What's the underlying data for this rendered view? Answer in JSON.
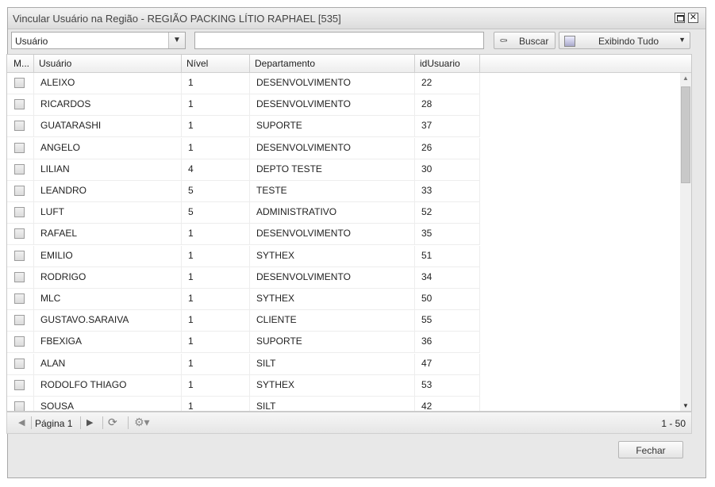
{
  "window": {
    "title": "Vincular Usuário na Região - REGIÃO PACKING LÍTIO RAPHAEL [535]",
    "close_glyph": "✕"
  },
  "toolbar": {
    "field_select": "Usuário",
    "search_value": "",
    "buscar_label": "Buscar",
    "buscar_icon": "filter-icon",
    "exibindo_label": "Exibindo Tudo"
  },
  "grid": {
    "columns": [
      "M...",
      "Usuário",
      "Nível",
      "Departamento",
      "idUsuario"
    ],
    "rows": [
      {
        "usuario": "ALEIXO",
        "nivel": "1",
        "departamento": "DESENVOLVIMENTO",
        "id": "22"
      },
      {
        "usuario": "RICARDOS",
        "nivel": "1",
        "departamento": "DESENVOLVIMENTO",
        "id": "28"
      },
      {
        "usuario": "GUATARASHI",
        "nivel": "1",
        "departamento": "SUPORTE",
        "id": "37"
      },
      {
        "usuario": "ANGELO",
        "nivel": "1",
        "departamento": "DESENVOLVIMENTO",
        "id": "26"
      },
      {
        "usuario": "LILIAN",
        "nivel": "4",
        "departamento": "DEPTO TESTE",
        "id": "30"
      },
      {
        "usuario": "LEANDRO",
        "nivel": "5",
        "departamento": "TESTE",
        "id": "33"
      },
      {
        "usuario": "LUFT",
        "nivel": "5",
        "departamento": "ADMINISTRATIVO",
        "id": "52"
      },
      {
        "usuario": "RAFAEL",
        "nivel": "1",
        "departamento": "DESENVOLVIMENTO",
        "id": "35"
      },
      {
        "usuario": "EMILIO",
        "nivel": "1",
        "departamento": "SYTHEX",
        "id": "51"
      },
      {
        "usuario": "RODRIGO",
        "nivel": "1",
        "departamento": "DESENVOLVIMENTO",
        "id": "34"
      },
      {
        "usuario": "MLC",
        "nivel": "1",
        "departamento": "SYTHEX",
        "id": "50"
      },
      {
        "usuario": "GUSTAVO.SARAIVA",
        "nivel": "1",
        "departamento": "CLIENTE",
        "id": "55"
      },
      {
        "usuario": "FBEXIGA",
        "nivel": "1",
        "departamento": "SUPORTE",
        "id": "36"
      },
      {
        "usuario": "ALAN",
        "nivel": "1",
        "departamento": "SILT",
        "id": "47"
      },
      {
        "usuario": "RODOLFO THIAGO",
        "nivel": "1",
        "departamento": "SYTHEX",
        "id": "53"
      },
      {
        "usuario": "SOUSA",
        "nivel": "1",
        "departamento": "SILT",
        "id": "42"
      }
    ]
  },
  "pager": {
    "page_label": "Página 1",
    "range_label": "1 - 50"
  },
  "footer": {
    "close_label": "Fechar"
  }
}
